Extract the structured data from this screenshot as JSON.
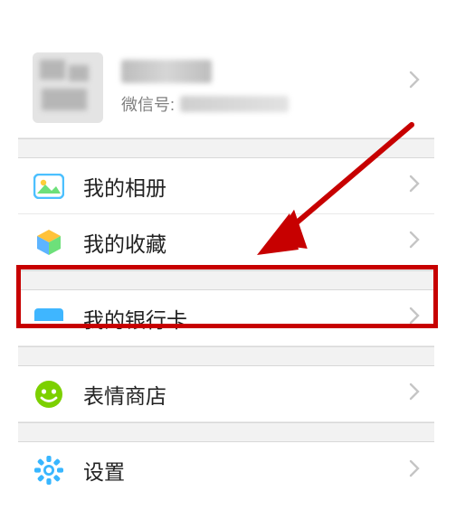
{
  "profile": {
    "wechat_label": "微信号:"
  },
  "menu": {
    "album": "我的相册",
    "favorites": "我的收藏",
    "bankcard": "我的银行卡",
    "sticker_shop": "表情商店",
    "settings": "设置"
  },
  "colors": {
    "highlight": "#c70000",
    "album_icon": "#4cc0ff",
    "favorites_icon_top": "#ffc23a",
    "favorites_icon_left": "#5db4ff",
    "favorites_icon_right": "#6de07a",
    "bankcard_icon": "#3fb6ff",
    "emoji_icon": "#7cd000",
    "settings_icon": "#38b6ff"
  }
}
